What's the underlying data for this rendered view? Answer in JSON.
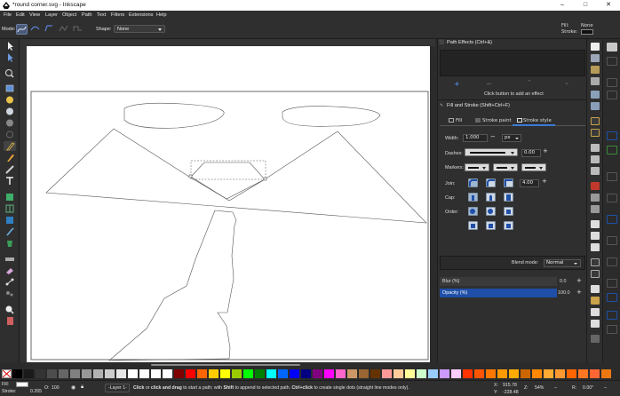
{
  "window": {
    "title": "*round corner.svg - Inkscape",
    "controls": [
      "–",
      "□",
      "✕"
    ]
  },
  "menu": [
    "File",
    "Edit",
    "View",
    "Layer",
    "Object",
    "Path",
    "Text",
    "Filters",
    "Extensions",
    "Help"
  ],
  "tool_controls": {
    "mode_label": "Mode:",
    "shape_label": "Shape:",
    "shape_value": "None"
  },
  "style_indicator": {
    "fill_label": "Fill:",
    "fill_value": "None",
    "stroke_label": "Stroke:"
  },
  "path_effects": {
    "title": "Path Effects (Ctrl+&)",
    "hint": "Click button to add an effect"
  },
  "fill_stroke": {
    "title": "Fill and Stroke (Shift+Ctrl+F)",
    "tabs": [
      "Fill",
      "Stroke paint",
      "Stroke style"
    ],
    "active_tab": 2,
    "width_label": "Width:",
    "width_value": "1.000",
    "width_unit": "px",
    "dashes_label": "Dashes:",
    "dashes_value": "0.00",
    "markers_label": "Markers:",
    "join_label": "Join:",
    "miter_value": "4.00",
    "cap_label": "Cap:",
    "order_label": "Order:",
    "blend_label": "Blend mode:",
    "blend_value": "Normal",
    "blur_label": "Blur (%)",
    "blur_value": "0.0",
    "opacity_label": "Opacity (%)",
    "opacity_value": "100.0"
  },
  "status": {
    "fill_label": "Fill:",
    "stroke_label": "Stroke:",
    "stroke_width": "0.265",
    "opacity_label": "O:",
    "opacity_value": "100",
    "layer": "-Layer 1-",
    "message_parts": [
      {
        "text": "Click",
        "bold": true
      },
      {
        "text": " or ",
        "bold": false
      },
      {
        "text": "click and drag",
        "bold": true
      },
      {
        "text": " to start a path; with ",
        "bold": false
      },
      {
        "text": "Shift",
        "bold": true
      },
      {
        "text": " to append to selected path. ",
        "bold": false
      },
      {
        "text": "Ctrl+click",
        "bold": true
      },
      {
        "text": " to create single dots (straight line modes only).",
        "bold": false
      }
    ],
    "x_label": "X:",
    "x_value": "915.78",
    "y_label": "Y:",
    "y_value": "-228.48",
    "zoom_label": "Z:",
    "zoom_value": "54%",
    "rotation_label": "R:",
    "rotation_value": "0.00°"
  },
  "colors": {
    "accent": "#1f4fa8",
    "opacity_bar": "#1f4fa8",
    "palette": [
      "#000000",
      "#1a1a1a",
      "#333333",
      "#4d4d4d",
      "#666666",
      "#808080",
      "#999999",
      "#b3b3b3",
      "#cccccc",
      "#e6e6e6",
      "#ffffff",
      "#ffffff",
      "#ffffff",
      "#ffffff",
      "#800000",
      "#ff0000",
      "#ff6600",
      "#ffcc00",
      "#ffff00",
      "#99cc00",
      "#00ff00",
      "#008000",
      "#00ffff",
      "#0066ff",
      "#0000ff",
      "#000080",
      "#800080",
      "#ff00ff",
      "#ff66cc",
      "#cc9966",
      "#996633",
      "#663300",
      "#ff9999",
      "#ffcc99",
      "#ffff99",
      "#ccffcc",
      "#99ccff",
      "#cc99ff",
      "#ffccff",
      "#ff3300",
      "#ff5500",
      "#ff7700",
      "#ff9900",
      "#ffaa00",
      "#cc6600",
      "#ff8800",
      "#ffaa33",
      "#ff9933",
      "#ff6600",
      "#ff7722",
      "#ff6633",
      "#ee7711"
    ]
  },
  "icons": {
    "tools": [
      "selector-icon",
      "node-icon",
      "tweak-icon",
      "zoom-icon",
      "rectangle-icon",
      "3dbox-icon",
      "ellipse-icon",
      "star-icon",
      "spiral-icon",
      "pencil-icon",
      "pen-icon",
      "calligraphy-icon",
      "text-icon",
      "spray-icon",
      "eraser-icon",
      "bucket-icon",
      "gradient-icon",
      "mesh-icon",
      "dropper-icon",
      "connector-icon",
      "measure-icon"
    ]
  }
}
